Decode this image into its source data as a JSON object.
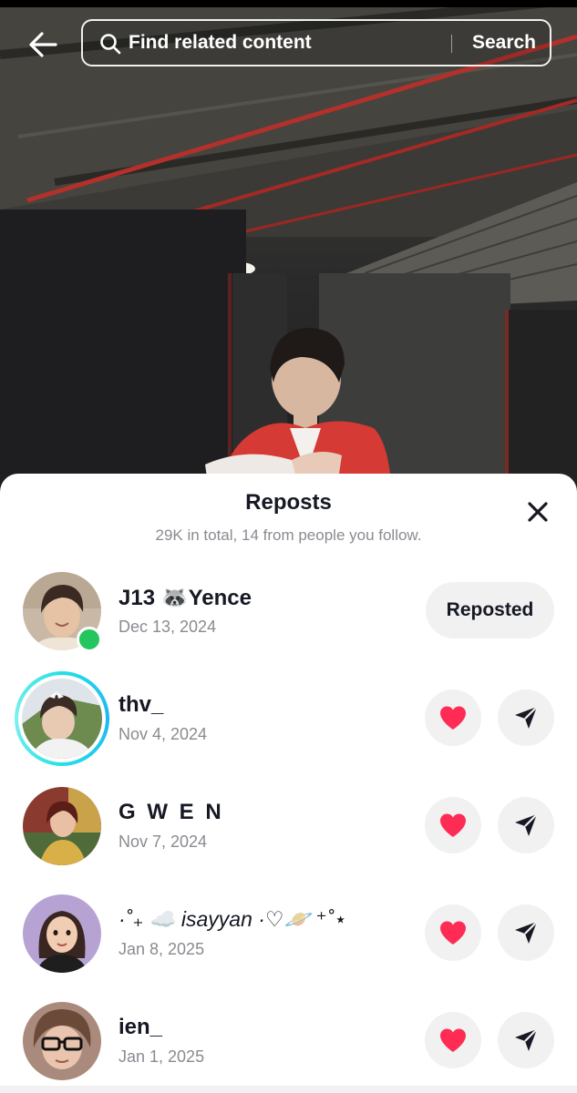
{
  "search": {
    "placeholder": "Find related content",
    "button_label": "Search"
  },
  "icons": {
    "back": "arrow-left-icon",
    "search": "magnifier-icon",
    "close": "close-x-icon",
    "like": "heart-icon",
    "send": "paper-plane-icon"
  },
  "colors": {
    "heart": "#fe2c55",
    "online": "#22c55e",
    "story_ring": "#25e0e6",
    "button_bg": "#f1f1f2",
    "secondary_text": "#8a8b91"
  },
  "sheet": {
    "title": "Reposts",
    "subtitle": "29K in total, 14 from people you follow."
  },
  "reposts": [
    {
      "username": "J13 🦝Yence",
      "date": "Dec 13, 2024",
      "action_label": "Reposted",
      "online": true
    },
    {
      "username": "thv_",
      "date": "Nov 4, 2024",
      "story": true
    },
    {
      "username": "G W E N",
      "date": "Nov 7, 2024"
    },
    {
      "username": "·˚₊ ☁️ isayyan ·♡🪐 ⁺˚⋆",
      "date": "Jan 8, 2025"
    },
    {
      "username": "ien_",
      "date": "Jan 1, 2025"
    }
  ]
}
